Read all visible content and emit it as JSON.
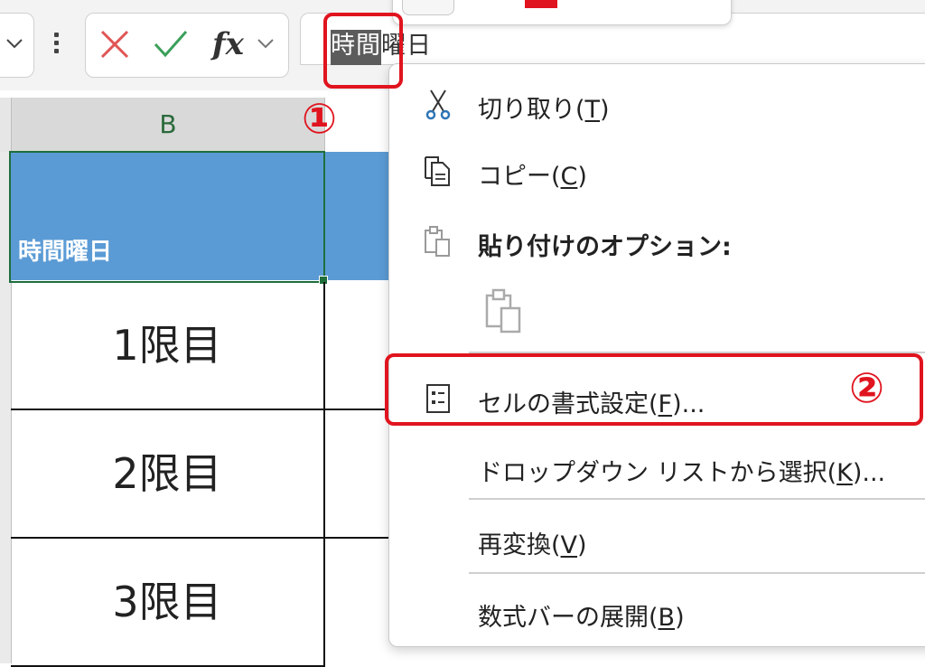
{
  "formula_bar": {
    "value_selected": "時間",
    "value_rest": "曜日",
    "fx_label": "fx"
  },
  "sheet": {
    "column_header": "B",
    "header_cell": "時間曜日",
    "rows": [
      "1限目",
      "2限目",
      "3限目"
    ]
  },
  "annotations": {
    "step1": "①",
    "step2": "②"
  },
  "context_menu": {
    "cut": {
      "text": "切り取り(",
      "key": "T",
      "end": ")"
    },
    "copy": {
      "text": "コピー(",
      "key": "C",
      "end": ")"
    },
    "paste_options": "貼り付けのオプション:",
    "format_cells": {
      "text": "セルの書式設定(",
      "key": "F",
      "end": ")..."
    },
    "pick_list": {
      "text": "ドロップダウン リストから選択(",
      "key": "K",
      "end": ")..."
    },
    "reconvert": {
      "text": "再変換(",
      "key": "V",
      "end": ")"
    },
    "expand_formula_bar": {
      "text": "数式バーの展開(",
      "key": "B",
      "end": ")"
    }
  },
  "colors": {
    "accent_red": "#e0141e",
    "header_fill": "#5b9bd5",
    "selection_green": "#1e6e3c"
  }
}
